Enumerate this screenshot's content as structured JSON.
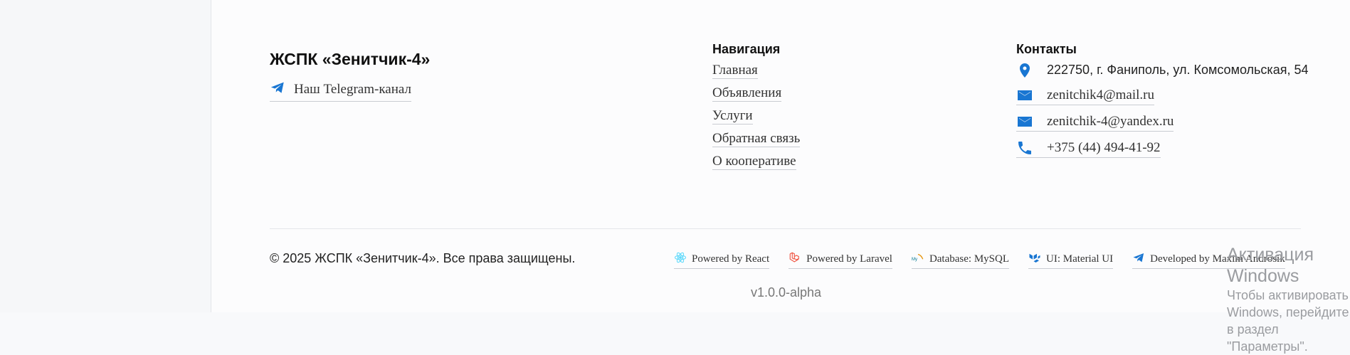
{
  "footer": {
    "brand": "ЖСПК «Зенитчик-4»",
    "telegram_link": "Наш Telegram-канал",
    "navigation": {
      "title": "Навигация",
      "items": [
        "Главная",
        "Объявления",
        "Услуги",
        "Обратная связь",
        "О кооперативе"
      ]
    },
    "contacts": {
      "title": "Контакты",
      "address": "222750, г. Фаниполь, ул. Комсомольская, 54",
      "email1": "zenitchik4@mail.ru",
      "email2": "zenitchik-4@yandex.ru",
      "phone": "+375 (44) 494-41-92"
    },
    "copyright": "© 2025 ЖСПК «Зенитчик-4». Все права защищены.",
    "badges": [
      {
        "label": "Powered by React",
        "icon": "react-icon"
      },
      {
        "label": "Powered by Laravel",
        "icon": "laravel-icon"
      },
      {
        "label": "Database: MySQL",
        "icon": "mysql-icon"
      },
      {
        "label": "UI: Material UI",
        "icon": "material-ui-icon"
      },
      {
        "label": "Developed by Maxim Androsik",
        "icon": "telegram-icon"
      }
    ],
    "version": "v1.0.0-alpha"
  },
  "windows_watermark": {
    "title": "Активация Windows",
    "line1": "Чтобы активировать Windows, перейдите в раздел",
    "line2": "\"Параметры\"."
  },
  "colors": {
    "accent": "#1976d2",
    "react": "#61dafb",
    "laravel": "#f05340",
    "mysql": "#00758f"
  }
}
